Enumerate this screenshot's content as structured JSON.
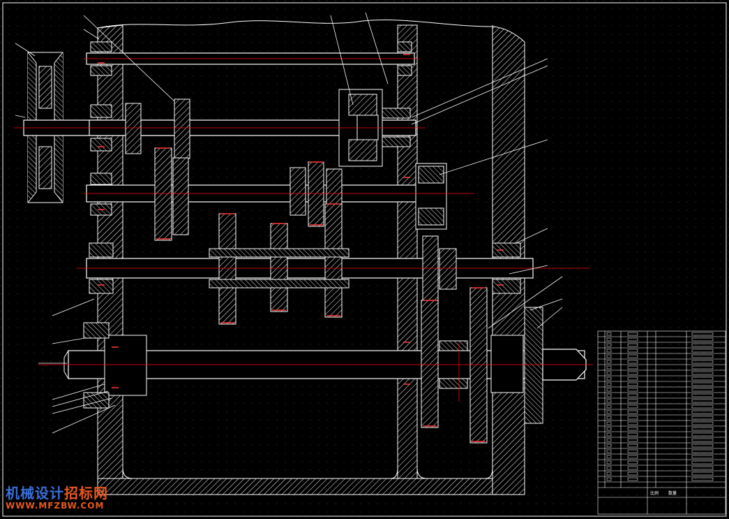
{
  "drawing": {
    "background": "#000000",
    "line_color": "#ffffff",
    "center_line_color": "#ff0000",
    "highlight_color": "#ff3b3b"
  },
  "watermark": {
    "line1_part1": "机械设计",
    "line1_part2": "招标网",
    "line2": "WWW.MFZBW.COM",
    "color_blue": "#3a6fd8",
    "color_orange": "#e8581e"
  },
  "title_block": {
    "label_left": "比例",
    "label_mid": "数量"
  }
}
